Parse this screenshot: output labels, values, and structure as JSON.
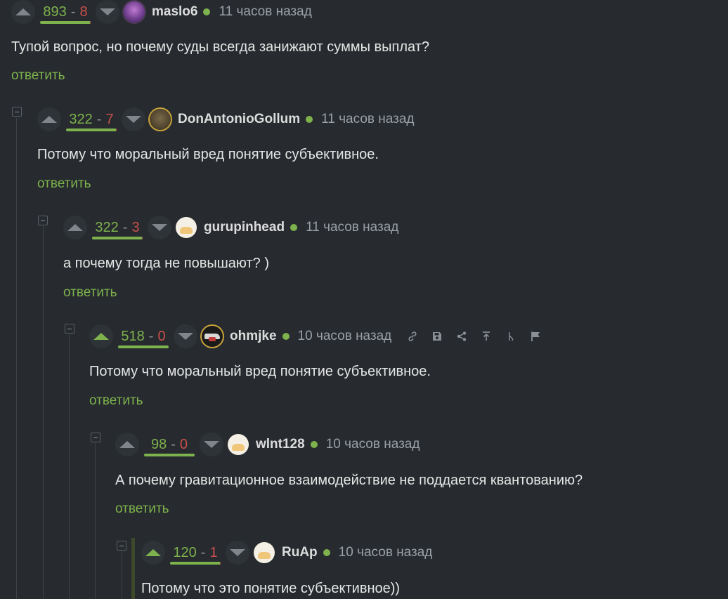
{
  "reply_label": "ответить",
  "colors": {
    "background": "#272b2f",
    "positive": "#7db24c",
    "negative": "#c9504c",
    "muted": "#9aa0a6"
  },
  "comments": [
    {
      "user": "maslo6",
      "time": "11 часов назад",
      "rating_pos": "893",
      "rating_sep": "-",
      "rating_neg": "8",
      "neg_share": 0.009,
      "avatar": "purple-creature-avatar",
      "online": true,
      "text": "Тупой вопрос, но почему суды всегда занижают суммы выплат?"
    },
    {
      "user": "DonAntonioGollum",
      "time": "11 часов назад",
      "rating_pos": "322",
      "rating_sep": "-",
      "rating_neg": "7",
      "neg_share": 0.021,
      "avatar": "owl-avatar",
      "online": true,
      "text": "Потому что моральный вред понятие субъективное."
    },
    {
      "user": "gurupinhead",
      "time": "11 часов назад",
      "rating_pos": "322",
      "rating_sep": "-",
      "rating_neg": "3",
      "neg_share": 0.009,
      "avatar": "default-avatar",
      "online": true,
      "text": "а почему тогда не повышают? )"
    },
    {
      "user": "ohmjke",
      "time": "10 часов назад",
      "rating_pos": "518",
      "rating_sep": "-",
      "rating_neg": "0",
      "neg_share": 0,
      "avatar": "car-avatar",
      "online": true,
      "upvoted": true,
      "tools": [
        "link-icon",
        "save-icon",
        "share-icon",
        "go-to-parent-icon",
        "branch-icon",
        "flag-icon"
      ],
      "text": "Потому что моральный вред понятие субъективное."
    },
    {
      "user": "wlnt128",
      "time": "10 часов назад",
      "rating_pos": "98",
      "rating_sep": "-",
      "rating_neg": "0",
      "neg_share": 0,
      "avatar": "default-avatar",
      "online": true,
      "text": "А почему гравитационное взаимодействие не поддается квантованию?"
    },
    {
      "user": "RuAp",
      "time": "10 часов назад",
      "rating_pos": "120",
      "rating_sep": "-",
      "rating_neg": "1",
      "neg_share": 0.008,
      "avatar": "default-avatar",
      "online": true,
      "upvoted": true,
      "text": "Потому что это понятие субъективное))"
    }
  ]
}
